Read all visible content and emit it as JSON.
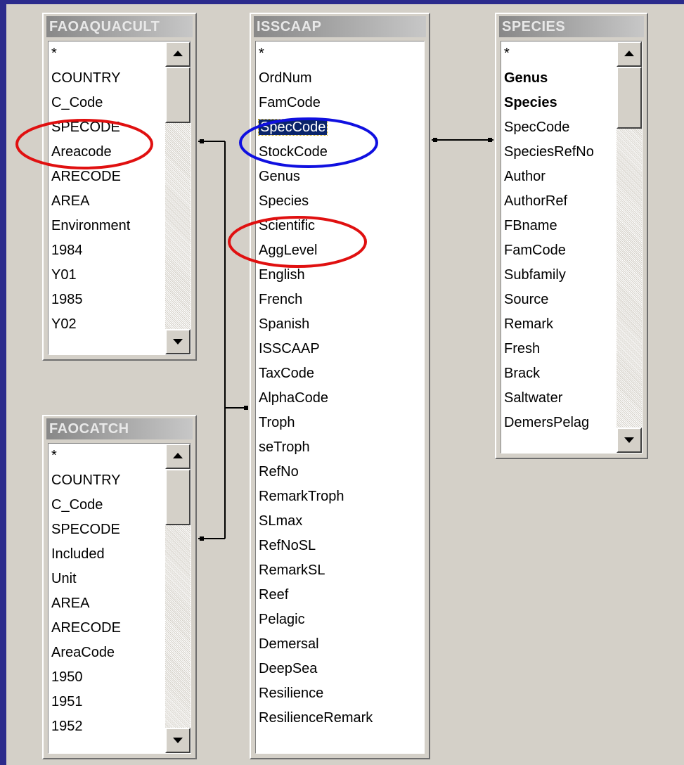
{
  "tables": [
    {
      "id": "faoaquacult",
      "title": "FAOAQUACULT",
      "fields": [
        "*",
        "COUNTRY",
        "C_Code",
        "SPECODE",
        "Areacode",
        "ARECODE",
        "AREA",
        "Environment",
        "1984",
        "Y01",
        "1985",
        "Y02"
      ],
      "has_scrollbar": true
    },
    {
      "id": "isscaap",
      "title": "ISSCAAP",
      "fields": [
        "*",
        "OrdNum",
        "FamCode",
        "SpecCode",
        "StockCode",
        "Genus",
        "Species",
        "Scientific",
        "AggLevel",
        "English",
        "French",
        "Spanish",
        "ISSCAAP",
        "TaxCode",
        "AlphaCode",
        "Troph",
        "seTroph",
        "RefNo",
        "RemarkTroph",
        "SLmax",
        "RefNoSL",
        "RemarkSL",
        "Reef",
        "Pelagic",
        "Demersal",
        "DeepSea",
        "Resilience",
        "ResilienceRemark"
      ],
      "selected_field": "SpecCode",
      "has_scrollbar": false
    },
    {
      "id": "species",
      "title": "SPECIES",
      "fields": [
        "*",
        "Genus",
        "Species",
        "SpecCode",
        "SpeciesRefNo",
        "Author",
        "AuthorRef",
        "FBname",
        "FamCode",
        "Subfamily",
        "Source",
        "Remark",
        "Fresh",
        "Brack",
        "Saltwater",
        "DemersPelag"
      ],
      "bold_fields": [
        "Genus",
        "Species"
      ],
      "has_scrollbar": true
    },
    {
      "id": "faocatch",
      "title": "FAOCATCH",
      "fields": [
        "*",
        "COUNTRY",
        "C_Code",
        "SPECODE",
        "Included",
        "Unit",
        "AREA",
        "ARECODE",
        "AreaCode",
        "1950",
        "1951",
        "1952"
      ],
      "has_scrollbar": true
    }
  ],
  "annotations": [
    {
      "shape": "ellipse",
      "color": "#e01010",
      "marks_field": "FAOAQUACULT.SPECODE"
    },
    {
      "shape": "ellipse",
      "color": "#1010e0",
      "marks_field": "ISSCAAP.SpecCode"
    },
    {
      "shape": "ellipse",
      "color": "#e01010",
      "marks_field": "ISSCAAP.Scientific"
    }
  ],
  "colors": {
    "slide_border": "#2b2b8c",
    "canvas": "#d4d0c8",
    "selection": "#0a246a"
  }
}
